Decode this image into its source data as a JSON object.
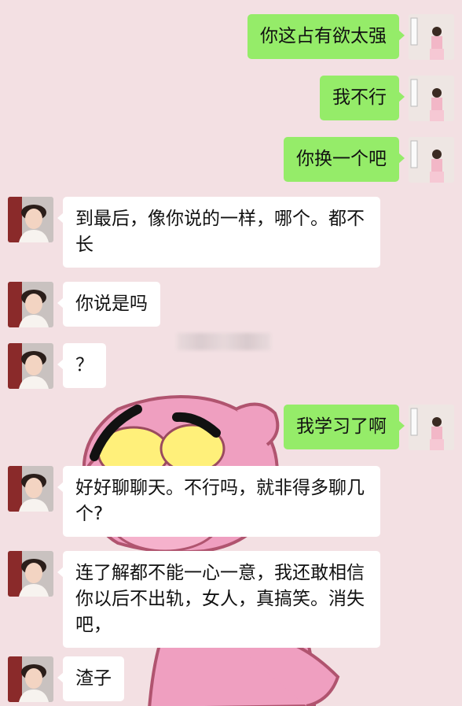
{
  "messages": [
    {
      "side": "right",
      "text": "你这占有欲太强",
      "avatar": "girl-avatar"
    },
    {
      "side": "right",
      "text": "我不行",
      "avatar": "girl-avatar"
    },
    {
      "side": "right",
      "text": "你换一个吧",
      "avatar": "girl-avatar"
    },
    {
      "side": "left",
      "text": "到最后，像你说的一样，哪个。都不长",
      "avatar": "boy-avatar"
    },
    {
      "side": "left",
      "text": "你说是吗",
      "avatar": "boy-avatar"
    },
    {
      "side": "left",
      "text": "？",
      "avatar": "boy-avatar"
    },
    {
      "side": "right",
      "text": "我学习了啊",
      "avatar": "girl-avatar"
    },
    {
      "side": "left",
      "text": "好好聊聊天。不行吗，就非得多聊几个?",
      "avatar": "boy-avatar"
    },
    {
      "side": "left",
      "text": "连了解都不能一心一意，我还敢相信你以后不出轨，女人，真搞笑。消失吧，",
      "avatar": "boy-avatar"
    },
    {
      "side": "left",
      "text": "渣子",
      "avatar": "boy-avatar"
    }
  ],
  "theme": {
    "background": "#f3e0e3",
    "outgoing_bubble": "#95ec69",
    "incoming_bubble": "#ffffff",
    "wallpaper": "pink-panther-cartoon"
  }
}
